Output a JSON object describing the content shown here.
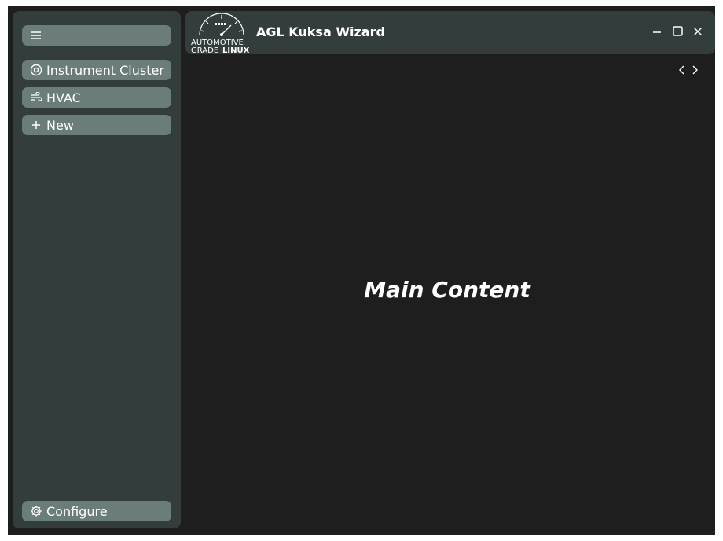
{
  "sidebar": {
    "menu_icon": "hamburger-icon",
    "items": [
      {
        "label": "Instrument Cluster",
        "icon": "gauge-icon"
      },
      {
        "label": "HVAC",
        "icon": "wind-icon"
      },
      {
        "label": "New",
        "icon": "plus-icon"
      }
    ],
    "configure": {
      "label": "Configure",
      "icon": "gear-icon"
    }
  },
  "header": {
    "logo_text_line1": "AUTOMOTIVE",
    "logo_text_line2_a": "GRADE",
    "logo_text_line2_b": "LINUX",
    "title": "AGL Kuksa Wizard",
    "controls": [
      "minimize-icon",
      "maximize-icon",
      "close-icon"
    ]
  },
  "nav": {
    "back_icon": "chevron-left-icon",
    "forward_icon": "chevron-right-icon"
  },
  "main": {
    "content_label": "Main Content"
  },
  "colors": {
    "background": "#1e1e1e",
    "panel": "#323d3c",
    "button": "#6b7d78",
    "text": "#ffffff"
  }
}
